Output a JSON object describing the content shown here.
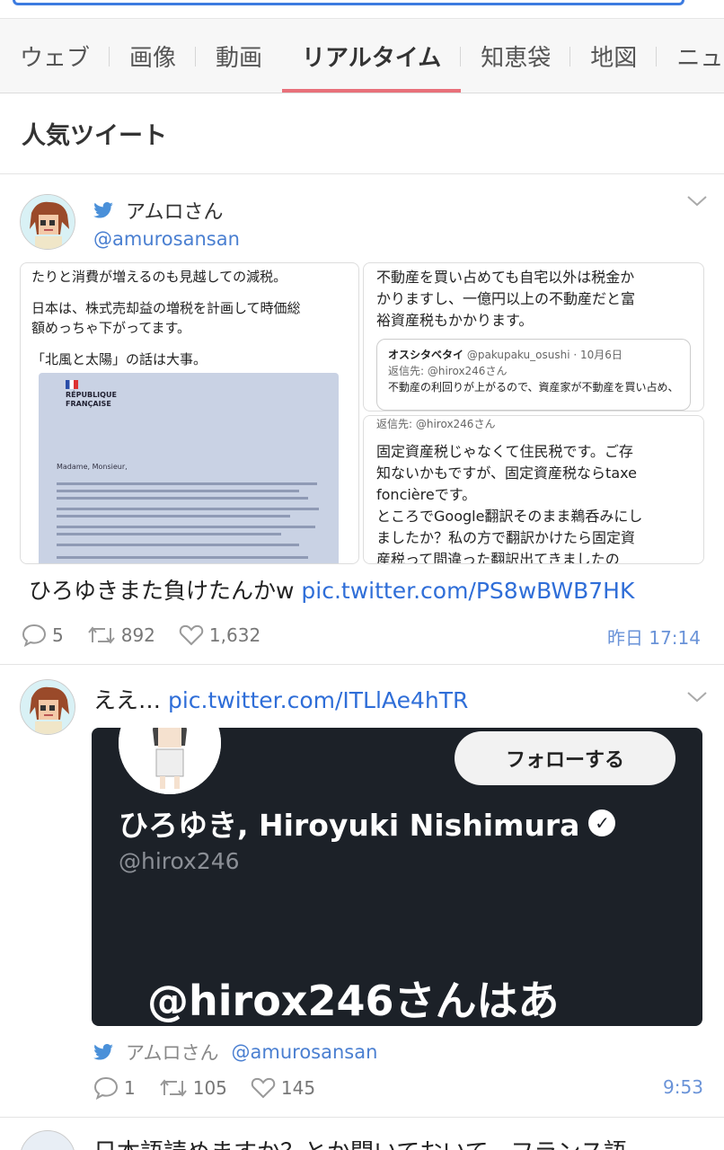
{
  "tabs": [
    {
      "label": "ウェブ",
      "active": false
    },
    {
      "label": "画像",
      "active": false
    },
    {
      "label": "動画",
      "active": false
    },
    {
      "label": "リアルタイム",
      "active": true
    },
    {
      "label": "知恵袋",
      "active": false
    },
    {
      "label": "地図",
      "active": false
    },
    {
      "label": "ニュ",
      "active": false
    }
  ],
  "section_title": "人気ツイート",
  "tweet1": {
    "name": "アムロさん",
    "handle": "@amurosansan",
    "img_left": {
      "line1": "たりと消費が増えるのも見越しての減税。",
      "line2": "日本は、株式売却益の増税を計画して時価総",
      "line3": "額めっちゃ下がってます。",
      "line4": "「北風と太陽」の話は大事。",
      "doc_org1": "RÉPUBLIQUE",
      "doc_org2": "FRANÇAISE",
      "doc_salutation": "Madame, Monsieur,"
    },
    "img_r1": {
      "line1": "不動産を買い占めても自宅以外は税金か",
      "line2": "かりますし、一億円以上の不動産だと富",
      "line3": "裕資産税もかかります。",
      "quote_name": "オスシタベタイ",
      "quote_handle": "@pakupaku_osushi · 10月6日",
      "quote_reply": "返信先: @hirox246さん",
      "quote_text": "不動産の利回りが上がるので、資産家が不動産を買い占め、"
    },
    "img_r2": {
      "reply": "返信先: @hirox246さん",
      "line1": "固定資産税じゃなくて住民税です。ご存",
      "line2": "知ないかもですが、固定資産税ならtaxe",
      "line3": "foncièreです。",
      "line4": "ところでGoogle翻訳そのまま鵜呑みにし",
      "line5": "ましたか？私の方で翻訳かけたら固定資",
      "line6": "産税って間違った翻訳出てきましたの"
    },
    "text": "ひろゆきまた負けたんかw ",
    "link": "pic.twitter.com/PS8wBWB7HK",
    "replies": "5",
    "retweets": "892",
    "likes": "1,632",
    "time": "昨日 17:14"
  },
  "tweet2": {
    "text": "ええ… ",
    "link": "pic.twitter.com/ITLlAe4hTR",
    "profile": {
      "follow_label": "フォローする",
      "name": "ひろゆき, Hiroyuki Nishimura",
      "handle": "@hirox246",
      "big_text": "@hirox246さんはあ"
    },
    "author_name": "アムロさん",
    "author_handle": "@amurosansan",
    "replies": "1",
    "retweets": "105",
    "likes": "145",
    "time": "9:53"
  },
  "tweet3": {
    "text": "日本語読めますか？とか聞いておいて、フランス語"
  },
  "colors": {
    "accent_tab": "#e8707a",
    "link": "#2f6ed8",
    "twitter": "#4a90d9"
  }
}
